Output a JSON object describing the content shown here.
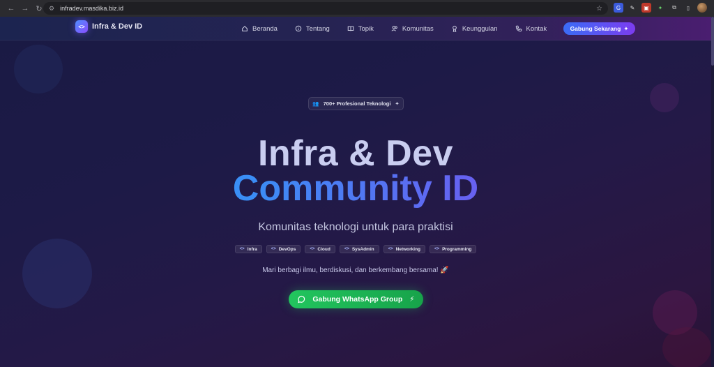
{
  "browser": {
    "url": "infradev.masdika.biz.id"
  },
  "navbar": {
    "brand": "Infra & Dev ID",
    "brand_icon": "code-brackets-icon",
    "items": [
      {
        "label": "Beranda",
        "icon": "home-icon"
      },
      {
        "label": "Tentang",
        "icon": "info-icon"
      },
      {
        "label": "Topik",
        "icon": "book-icon"
      },
      {
        "label": "Komunitas",
        "icon": "users-icon"
      },
      {
        "label": "Keunggulan",
        "icon": "award-icon"
      },
      {
        "label": "Kontak",
        "icon": "phone-icon"
      }
    ],
    "cta_label": "Gabung Sekarang"
  },
  "hero": {
    "badge": "700+ Profesional Teknologi",
    "title_line1": "Infra & Dev",
    "title_line2": "Community ID",
    "subtitle": "Komunitas teknologi untuk para praktisi",
    "tags": [
      "Infra",
      "DevOps",
      "Cloud",
      "SysAdmin",
      "Networking",
      "Programming"
    ],
    "tagline": "Mari berbagi ilmu, berdiskusi, dan berkembang bersama! 🚀",
    "cta_label": "Gabung WhatsApp Group"
  },
  "colors": {
    "accent_blue": "#3a6cf6",
    "accent_purple": "#7c3cf0",
    "whatsapp_green": "#22c55e"
  }
}
